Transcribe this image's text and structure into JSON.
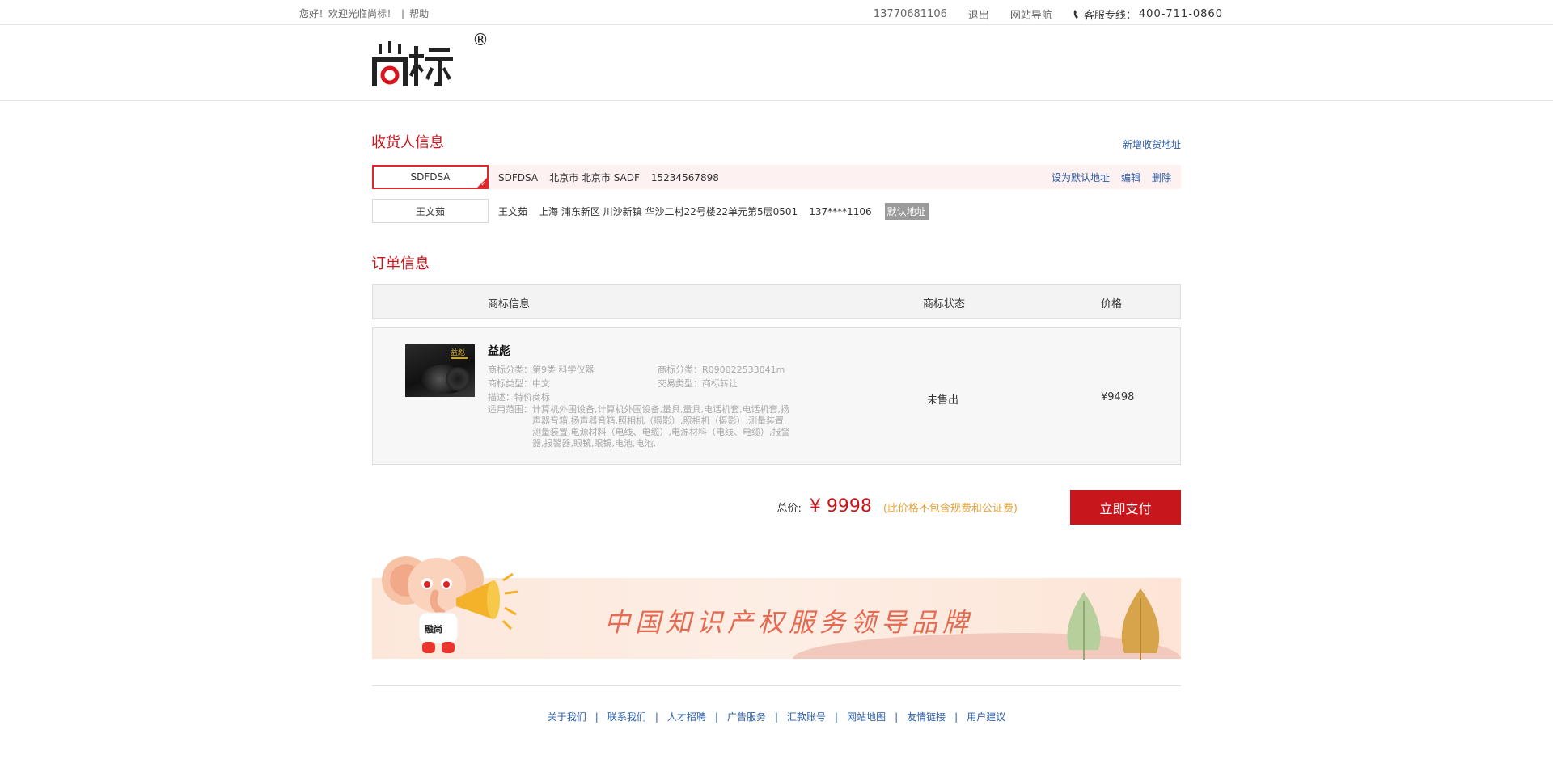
{
  "topbar": {
    "welcome": "您好！欢迎光临尚标！",
    "separator": "|",
    "help": "帮助",
    "phone_account": "13770681106",
    "logout": "退出",
    "site_nav": "网站导航",
    "hotline_label": "客服专线：",
    "hotline_number": "400-711-0860"
  },
  "header": {
    "logo_text": "尚标",
    "logo_mark": "®"
  },
  "consignee": {
    "title": "收货人信息",
    "new_address": "新增收货地址",
    "addresses": [
      {
        "name": "SDFDSA",
        "recipient": "SDFDSA",
        "region": "北京市 北京市 SADF",
        "phone": "15234567898",
        "actions": [
          "设为默认地址",
          "编辑",
          "删除"
        ]
      },
      {
        "name": "王文茹",
        "recipient": "王文茹",
        "region": "上海 浦东新区 川沙新镇 华沙二村22号楼22单元第5层0501",
        "phone": "137****1106",
        "tag": "默认地址"
      }
    ]
  },
  "order": {
    "title": "订单信息",
    "columns": [
      "商标信息",
      "商标状态",
      "价格"
    ],
    "item": {
      "name": "益彪",
      "image_text": "益彪",
      "category_label": "商标分类：",
      "category_value": "第9类 科学仪器",
      "reg_no_label": "商标分类：",
      "reg_no_value": "R090022533041m",
      "type_label": "商标类型：",
      "type_value": "中文",
      "trade_label": "交易类型：",
      "trade_value": "商标转让",
      "desc_label": "描述：",
      "desc_value": "特价商标",
      "scope_label": "适用范围：",
      "scope_value": "计算机外围设备,计算机外围设备,量具,量具,电话机套,电话机套,扬声器音箱,扬声器音箱,照相机（摄影）,照相机（摄影）,测量装置,测量装置,电源材料（电线、电缆）,电源材料（电线、电缆）,报警器,报警器,眼镜,眼镜,电池,电池,",
      "status": "未售出",
      "price": "¥9498"
    }
  },
  "summary": {
    "total_label": "总价:",
    "total_amount": "¥ 9998",
    "note": "(此价格不包含规费和公证费)",
    "pay_button": "立即支付"
  },
  "banner": {
    "slogan": "中国知识产权服务领导品牌",
    "mascot_shirt": "融尚"
  },
  "footer": {
    "links": [
      "关于我们",
      "联系我们",
      "人才招聘",
      "广告服务",
      "汇款账号",
      "网站地图",
      "友情链接",
      "用户建议"
    ]
  },
  "colors": {
    "brand_red": "#c8161d",
    "link_blue": "#2b5da8",
    "note_orange": "#e5a035",
    "default_tag_gray": "#9a9a9a"
  }
}
